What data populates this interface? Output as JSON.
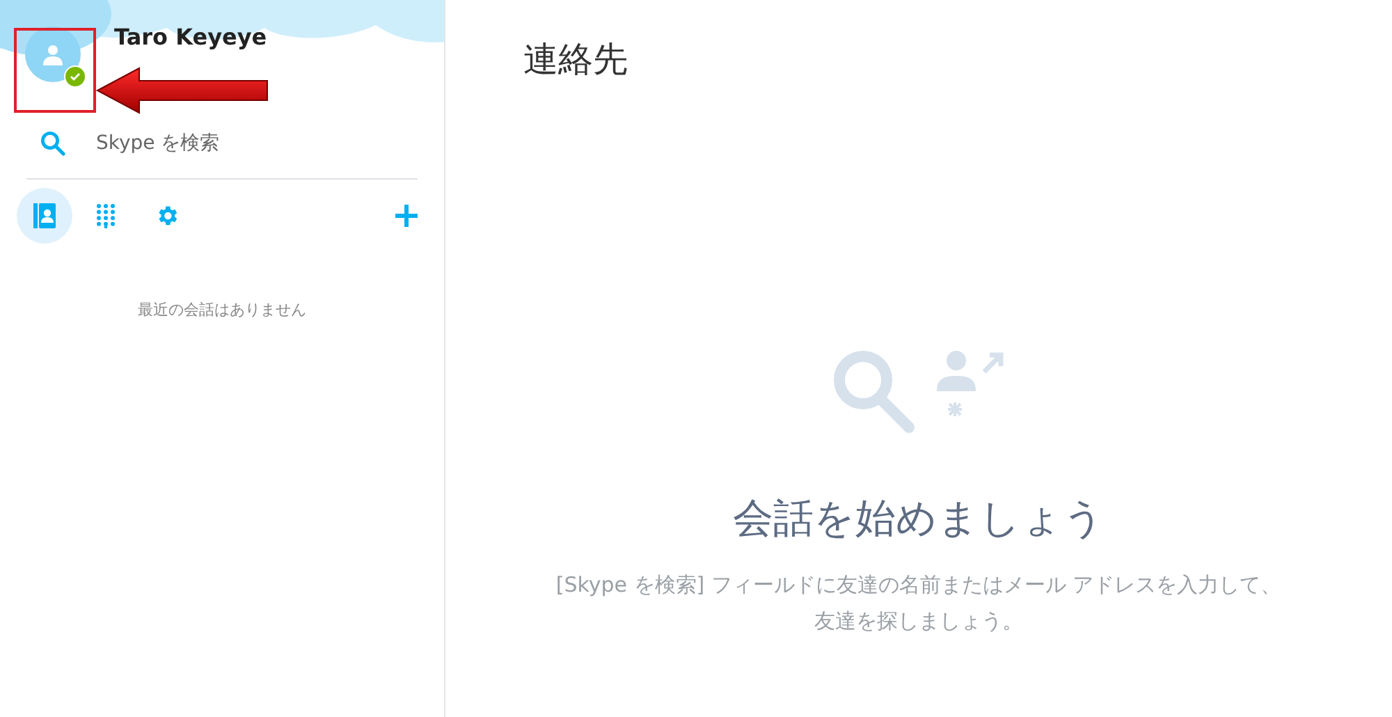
{
  "profile": {
    "name": "Taro Keyeye",
    "online": true
  },
  "search": {
    "placeholder": "Skype を検索"
  },
  "nav_tabs": [
    {
      "kind": "contacts",
      "selected": true
    },
    {
      "kind": "dialpad",
      "selected": false
    },
    {
      "kind": "settings",
      "selected": false
    }
  ],
  "recent": {
    "empty_message": "最近の会話はありません"
  },
  "main": {
    "title": "連絡先",
    "heading": "会話を始めましょう",
    "description_lines": [
      "[Skype を検索] フィールドに友達の名前またはメール アドレスを入力して、",
      "友達を探しましょう。"
    ]
  }
}
